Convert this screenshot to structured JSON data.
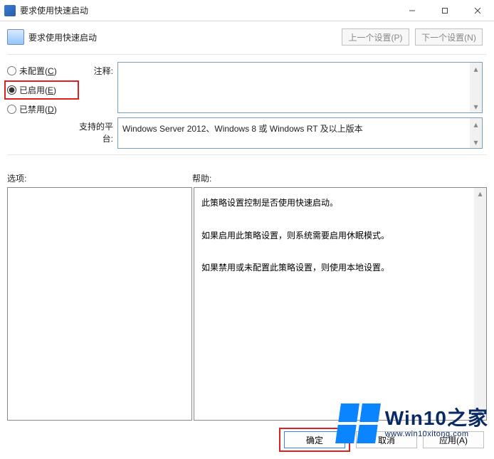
{
  "window": {
    "title": "要求使用快速启动"
  },
  "header": {
    "title": "要求使用快速启动",
    "prev_button": "上一个设置(P)",
    "next_button": "下一个设置(N)"
  },
  "radios": {
    "not_configured": "未配置",
    "not_configured_key": "C",
    "enabled": "已启用",
    "enabled_key": "E",
    "disabled": "已禁用",
    "disabled_key": "D",
    "selected": "enabled"
  },
  "labels": {
    "comment": "注释:",
    "supported_platform": "支持的平台:",
    "options": "选项:",
    "help": "帮助:"
  },
  "fields": {
    "comment": "",
    "supported_platform": "Windows Server 2012、Windows 8 或 Windows RT 及以上版本"
  },
  "help_text": {
    "line1": "此策略设置控制是否使用快速启动。",
    "line2": "如果启用此策略设置，则系统需要启用休眠模式。",
    "line3": "如果禁用或未配置此策略设置，则使用本地设置。"
  },
  "buttons": {
    "ok": "确定",
    "cancel": "取消",
    "apply": "应用(A)"
  },
  "watermark": {
    "brand": "Win10之家",
    "url": "www.win10xitong.com"
  }
}
